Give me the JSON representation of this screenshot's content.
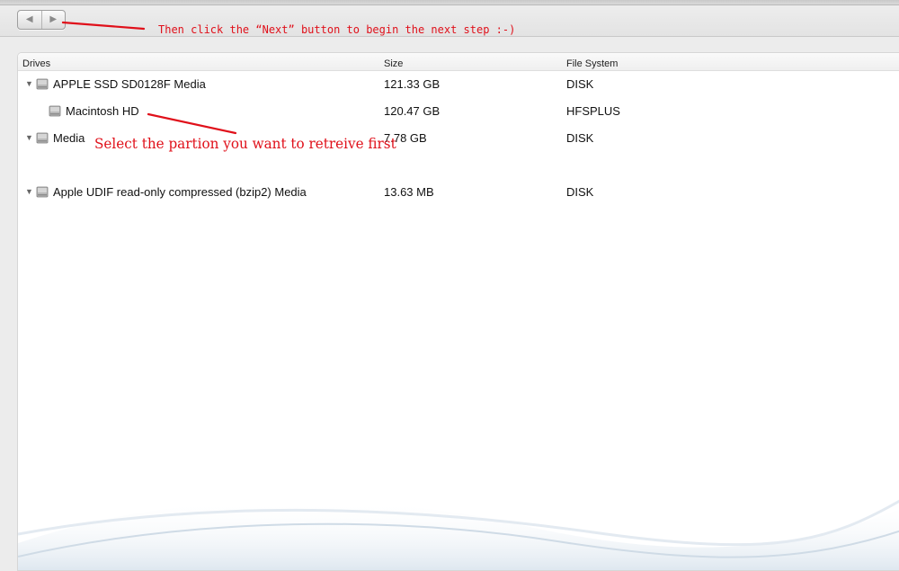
{
  "toolbar": {
    "back_icon": "left-triangle-icon",
    "next_icon": "right-triangle-icon",
    "back_glyph": "◀",
    "next_glyph": "▶"
  },
  "annotations": {
    "top_hint": "Then click the “Next” button to begin the next step :-)",
    "middle_hint": "Select the partion you want to retreive first",
    "color": "#e0101a"
  },
  "table": {
    "columns": {
      "drives": "Drives",
      "size": "Size",
      "file_system": "File System"
    },
    "rows": [
      {
        "name": "APPLE SSD SD0128F Media",
        "size": "121.33 GB",
        "fs": "DISK",
        "expanded": true
      },
      {
        "name": "Macintosh HD",
        "size": "120.47 GB",
        "fs": "HFSPLUS",
        "child": true
      },
      {
        "name": "Media",
        "size": "7.78 GB",
        "fs": "DISK",
        "expanded": true
      },
      {
        "name": "Apple UDIF read-only compressed (bzip2) Media",
        "size": "13.63 MB",
        "fs": "DISK",
        "expanded": true
      }
    ],
    "expander_glyph": "▼"
  }
}
